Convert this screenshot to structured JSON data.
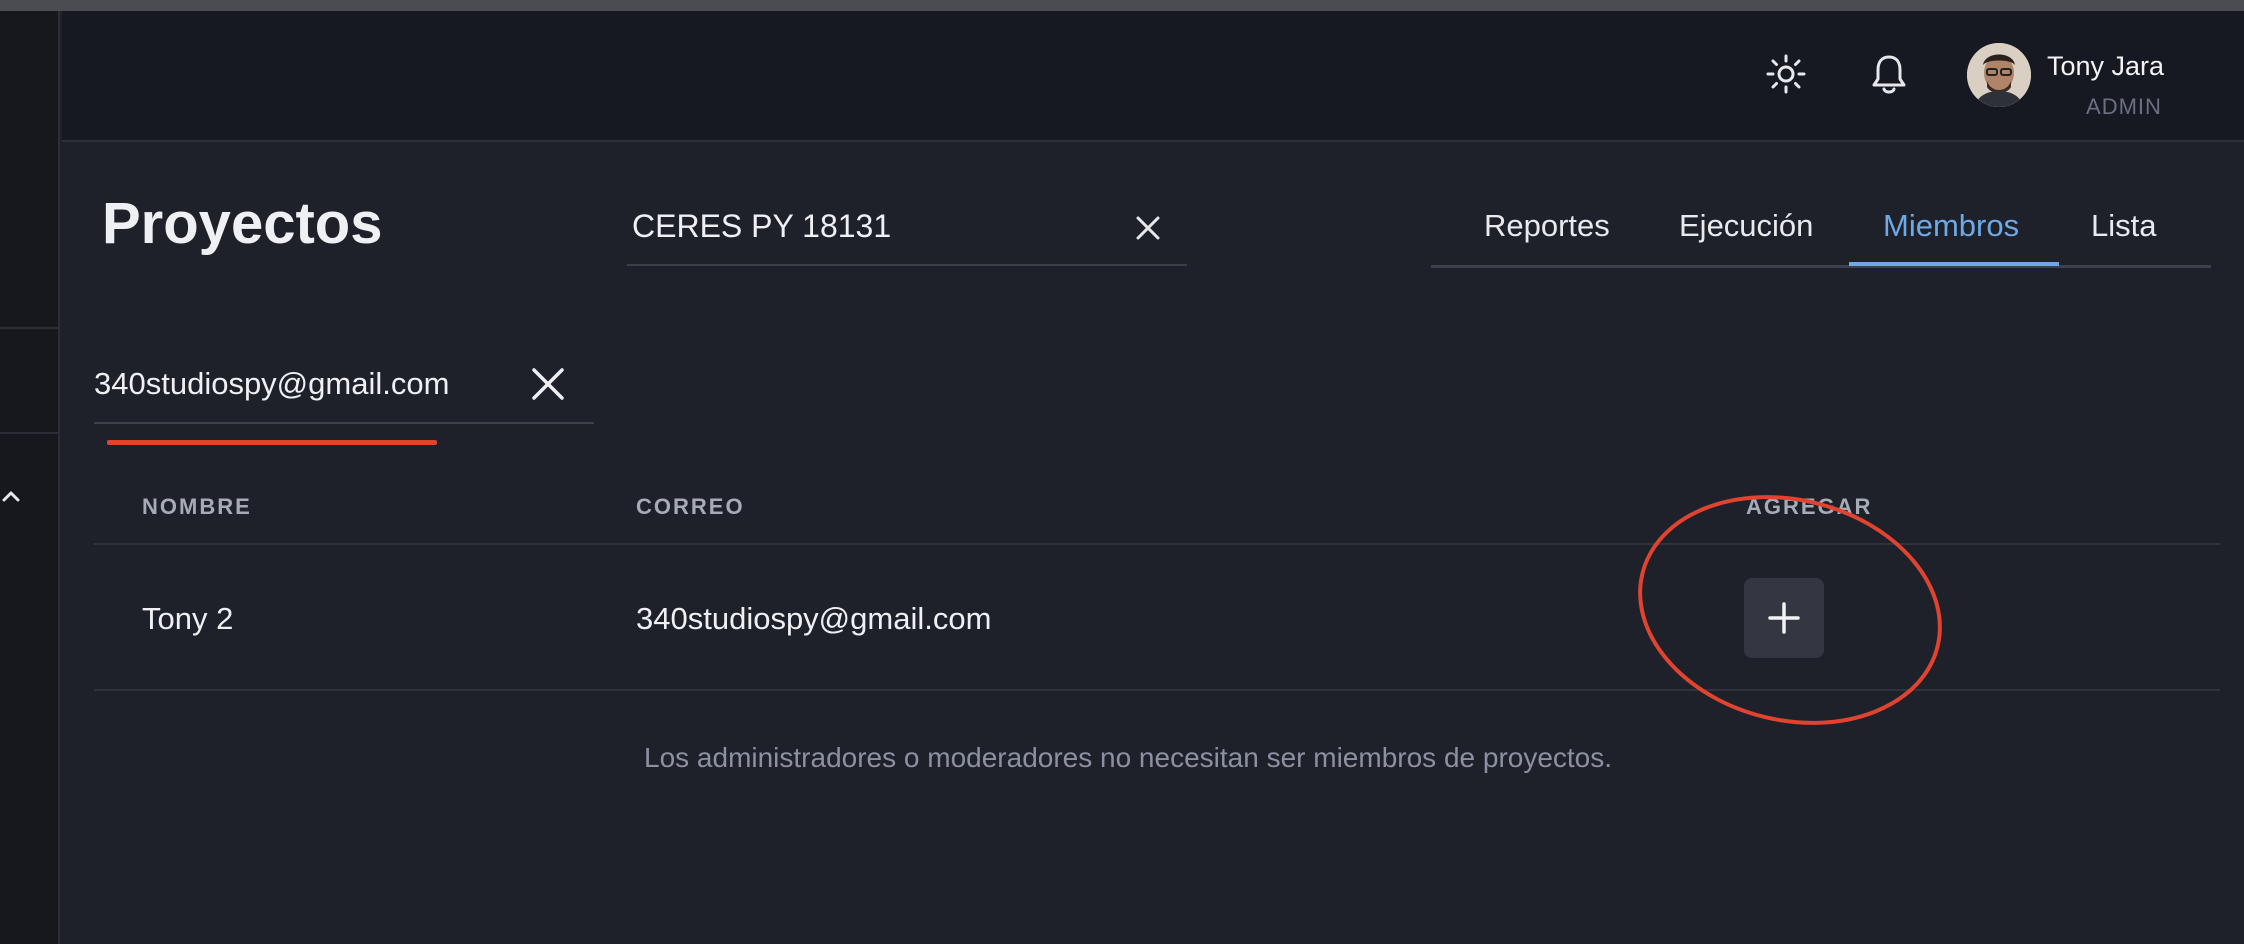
{
  "header": {
    "user_name": "Tony Jara",
    "user_role": "ADMIN",
    "icons": [
      "sun-icon",
      "bell-icon",
      "chevron-down-icon"
    ]
  },
  "page": {
    "title": "Proyectos"
  },
  "project_search": {
    "value": "CERES PY 18131"
  },
  "tabs": [
    {
      "label": "Reportes",
      "active": false
    },
    {
      "label": "Ejecución",
      "active": false
    },
    {
      "label": "Miembros",
      "active": true
    },
    {
      "label": "Lista",
      "active": false
    }
  ],
  "member_search": {
    "value": "340studiospy@gmail.com"
  },
  "table": {
    "headers": [
      "NOMBRE",
      "CORREO",
      "AGREGAR"
    ],
    "rows": [
      {
        "nombre": "Tony 2",
        "correo": "340studiospy@gmail.com"
      }
    ]
  },
  "note": "Los administradores o moderadores no necesitan ser miembros de proyectos.",
  "colors": {
    "accent": "#6ea8e6",
    "annotation": "#e0432f",
    "background": "#1e212a"
  }
}
